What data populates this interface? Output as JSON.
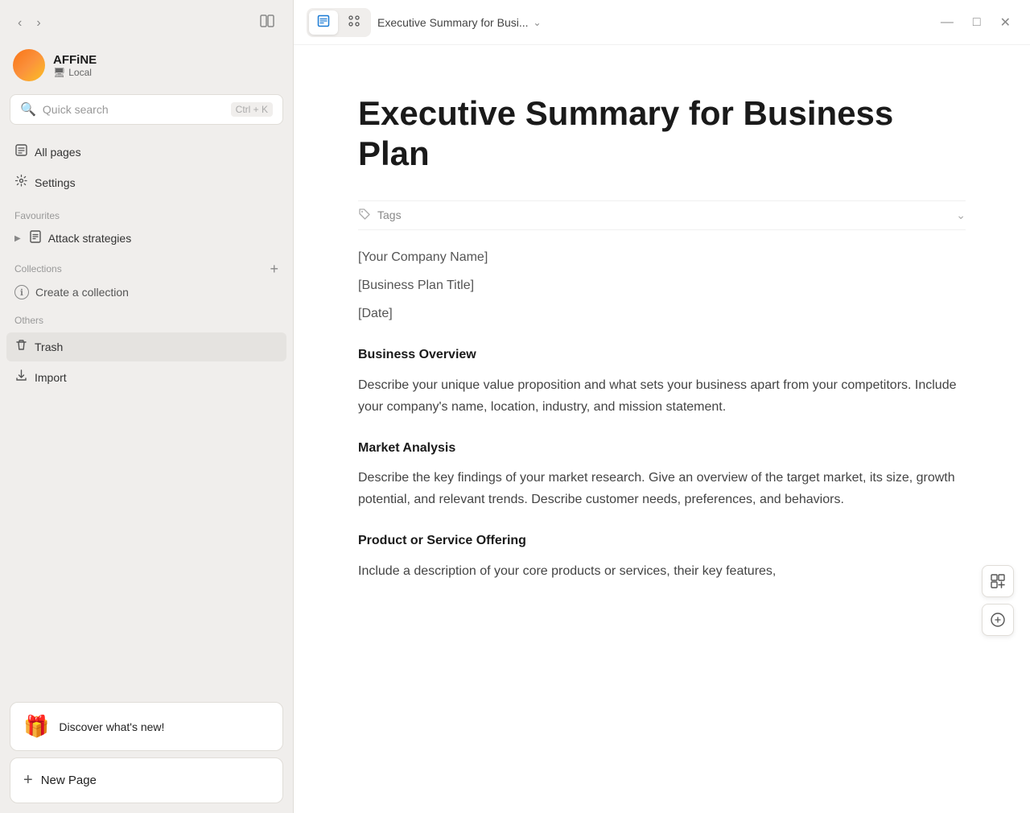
{
  "app": {
    "title": "AFFiNE"
  },
  "workspace": {
    "name": "AFFiNE",
    "type": "Local",
    "type_icon": "🖥"
  },
  "search": {
    "placeholder": "Quick search",
    "shortcut": "Ctrl + K"
  },
  "sidebar": {
    "nav_items": [
      {
        "id": "all-pages",
        "label": "All pages",
        "icon": "📁"
      },
      {
        "id": "settings",
        "label": "Settings",
        "icon": "⚙️"
      }
    ],
    "favourites_label": "Favourites",
    "favourites_items": [
      {
        "id": "attack-strategies",
        "label": "Attack strategies",
        "icon": "📄"
      }
    ],
    "collections_label": "Collections",
    "collections_add": "+",
    "collections_items": [
      {
        "id": "create-collection",
        "label": "Create a collection"
      }
    ],
    "others_label": "Others",
    "others_items": [
      {
        "id": "trash",
        "label": "Trash",
        "icon": "🗑"
      },
      {
        "id": "import",
        "label": "Import",
        "icon": "⬇"
      }
    ],
    "discover_label": "Discover what's new!",
    "new_page_label": "New Page"
  },
  "titlebar": {
    "doc_view_btn": "📄",
    "edgeless_view_btn": "🔀",
    "doc_title": "Executive Summary for Busi...",
    "window_minimize": "—",
    "window_maximize": "□",
    "window_close": "✕"
  },
  "document": {
    "title": "Executive Summary for Business Plan",
    "tags_label": "Tags",
    "placeholder_lines": [
      "[Your Company Name]",
      "[Business Plan Title]",
      "[Date]"
    ],
    "sections": [
      {
        "heading": "Business Overview",
        "text": "Describe your unique value proposition and what sets your business apart from your competitors. Include your company's name, location, industry, and mission statement."
      },
      {
        "heading": "Market Analysis",
        "text": "Describe the key findings of your market research. Give an overview of the target market, its size, growth potential, and relevant trends. Describe customer needs, preferences, and behaviors."
      },
      {
        "heading": "Product or Service Offering",
        "text": "Include a description of your core products or services, their key features,"
      }
    ]
  }
}
